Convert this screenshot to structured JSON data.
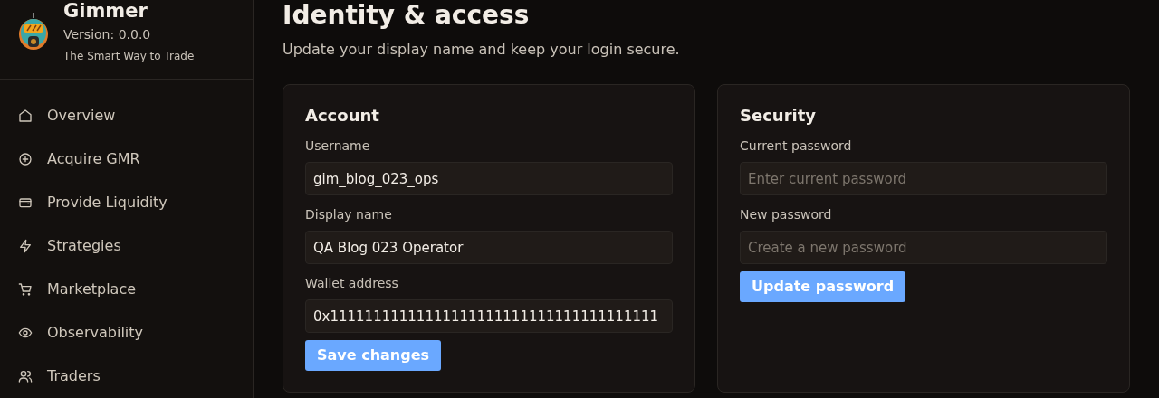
{
  "brand": {
    "name": "Gimmer",
    "version": "Version: 0.0.0",
    "tagline": "The Smart Way to Trade"
  },
  "nav": [
    {
      "label": "Overview"
    },
    {
      "label": "Acquire GMR"
    },
    {
      "label": "Provide Liquidity"
    },
    {
      "label": "Strategies"
    },
    {
      "label": "Marketplace"
    },
    {
      "label": "Observability"
    },
    {
      "label": "Traders"
    }
  ],
  "page": {
    "title": "Identity & access",
    "subtitle": "Update your display name and keep your login secure."
  },
  "cards": [
    {
      "title": "Account",
      "fields": [
        {
          "label": "Username",
          "value": "gim_blog_023_ops"
        },
        {
          "label": "Display name",
          "value": "QA Blog 023 Operator"
        },
        {
          "label": "Wallet address",
          "value": "0x11111111111111111111111111111111111111"
        }
      ],
      "button": "Save changes"
    },
    {
      "title": "Security",
      "fields": [
        {
          "label": "Current password",
          "placeholder": "Enter current password"
        },
        {
          "label": "New password",
          "placeholder": "Create a new password"
        }
      ],
      "button": "Update password"
    }
  ]
}
